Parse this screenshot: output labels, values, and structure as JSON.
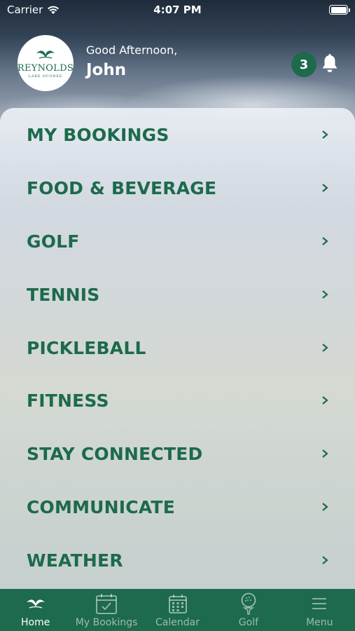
{
  "status_bar": {
    "carrier": "Carrier",
    "time": "4:07 PM"
  },
  "header": {
    "logo": {
      "wordmark": "REYNOLDS",
      "sub": "LAKE OCONEE"
    },
    "greeting": "Good Afternoon,",
    "user_name": "John",
    "notification_count": "3"
  },
  "menu": {
    "items": [
      {
        "label": "MY BOOKINGS"
      },
      {
        "label": "FOOD & BEVERAGE"
      },
      {
        "label": "GOLF"
      },
      {
        "label": "TENNIS"
      },
      {
        "label": "PICKLEBALL"
      },
      {
        "label": "FITNESS"
      },
      {
        "label": "STAY CONNECTED"
      },
      {
        "label": "COMMUNICATE"
      },
      {
        "label": "WEATHER"
      }
    ]
  },
  "tab_bar": {
    "tabs": [
      {
        "label": "Home",
        "icon": "home-logo-icon",
        "active": true
      },
      {
        "label": "My Bookings",
        "icon": "calendar-check-icon",
        "active": false
      },
      {
        "label": "Calendar",
        "icon": "calendar-grid-icon",
        "active": false
      },
      {
        "label": "Golf",
        "icon": "golf-ball-tee-icon",
        "active": false
      },
      {
        "label": "Menu",
        "icon": "hamburger-menu-icon",
        "active": false
      }
    ]
  },
  "colors": {
    "brand_green": "#1d6a4c",
    "white": "#ffffff"
  }
}
